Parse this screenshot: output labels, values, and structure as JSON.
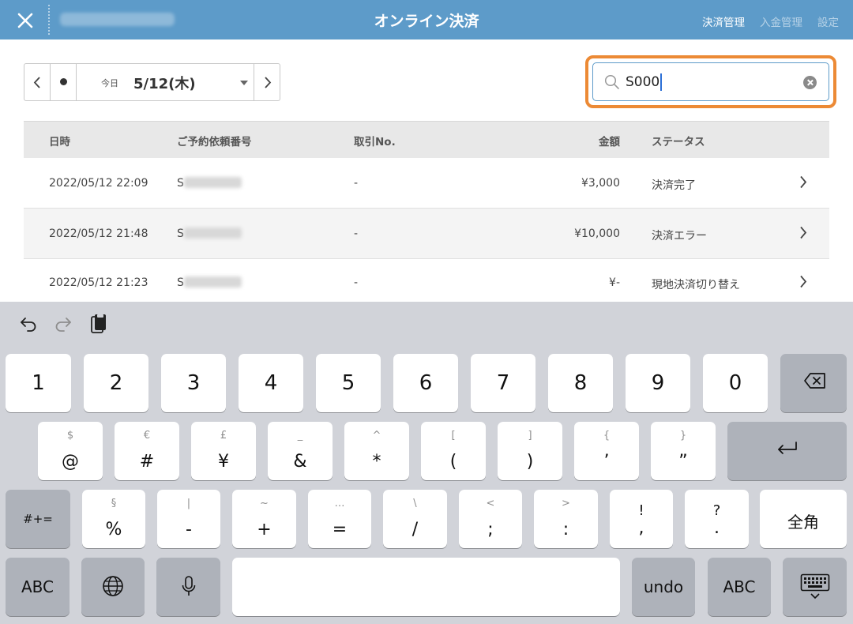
{
  "header": {
    "title": "オンライン決済",
    "nav": [
      "決済管理",
      "入金管理",
      "設定"
    ]
  },
  "date_nav": {
    "today_label": "今日",
    "date": "5/12(木)"
  },
  "search": {
    "value": "S000"
  },
  "table": {
    "columns": [
      "日時",
      "ご予約依頼番号",
      "取引No.",
      "金額",
      "ステータス"
    ],
    "rows": [
      {
        "datetime": "2022/05/12 22:09",
        "booking_prefix": "S",
        "transaction_no": "-",
        "amount": "¥3,000",
        "status": "決済完了"
      },
      {
        "datetime": "2022/05/12 21:48",
        "booking_prefix": "S",
        "transaction_no": "-",
        "amount": "¥10,000",
        "status": "決済エラー"
      },
      {
        "datetime": "2022/05/12 21:23",
        "booking_prefix": "S",
        "transaction_no": "-",
        "amount": "¥-",
        "status": "現地決済切り替え"
      }
    ]
  },
  "keyboard": {
    "row1": [
      "1",
      "2",
      "3",
      "4",
      "5",
      "6",
      "7",
      "8",
      "9",
      "0"
    ],
    "row2": [
      {
        "sub": "$",
        "main": "@"
      },
      {
        "sub": "€",
        "main": "#"
      },
      {
        "sub": "£",
        "main": "¥"
      },
      {
        "sub": "_",
        "main": "&"
      },
      {
        "sub": "^",
        "main": "*"
      },
      {
        "sub": "[",
        "main": "("
      },
      {
        "sub": "]",
        "main": ")"
      },
      {
        "sub": "{",
        "main": "’"
      },
      {
        "sub": "}",
        "main": "”"
      }
    ],
    "row3": [
      {
        "sub": "§",
        "main": "%"
      },
      {
        "sub": "|",
        "main": "-"
      },
      {
        "sub": "~",
        "main": "+"
      },
      {
        "sub": "…",
        "main": "="
      },
      {
        "sub": "\\",
        "main": "/"
      },
      {
        "sub": "<",
        "main": ";"
      },
      {
        "sub": ">",
        "main": ":"
      },
      {
        "sub": "!",
        "main": ","
      },
      {
        "sub": "?",
        "main": "."
      }
    ],
    "symbols_key": "#+=",
    "fullwidth_key": "全角",
    "abc_left": "ABC",
    "undo_key": "undo",
    "abc_right": "ABC",
    "icons": [
      "undo-icon",
      "redo-icon",
      "paste-icon",
      "delete-icon",
      "return-icon",
      "globe-icon",
      "microphone-icon",
      "hide-keyboard-icon"
    ]
  },
  "colors": {
    "header_bg": "#5d9bc9",
    "highlight": "#ec8a35",
    "keyboard_bg": "#d1d3d9",
    "key_dark": "#aeb2ba"
  }
}
